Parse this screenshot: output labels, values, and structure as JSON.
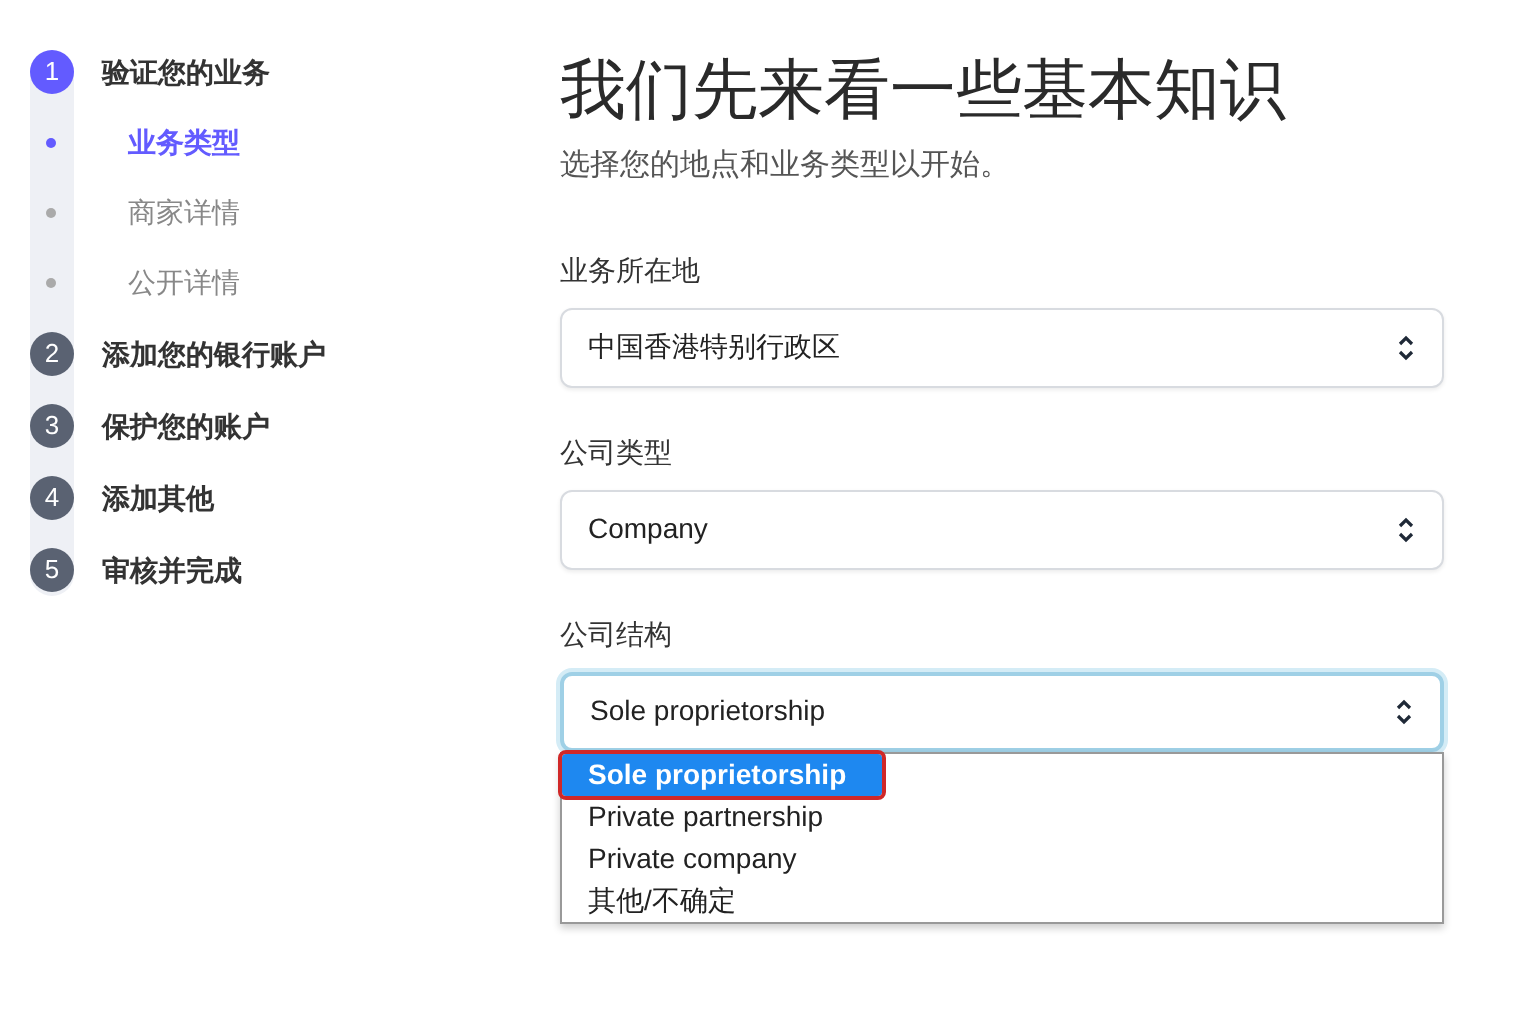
{
  "steps": [
    {
      "number": "1",
      "label": "验证您的业务",
      "current": true,
      "children": [
        {
          "label": "业务类型",
          "selected": true
        },
        {
          "label": "商家详情",
          "selected": false
        },
        {
          "label": "公开详情",
          "selected": false
        }
      ]
    },
    {
      "number": "2",
      "label": "添加您的银行账户",
      "current": false
    },
    {
      "number": "3",
      "label": "保护您的账户",
      "current": false
    },
    {
      "number": "4",
      "label": "添加其他",
      "current": false
    },
    {
      "number": "5",
      "label": "审核并完成",
      "current": false
    }
  ],
  "heading": "我们先来看一些基本知识",
  "subheading": "选择您的地点和业务类型以开始。",
  "fields": [
    {
      "label": "业务所在地",
      "value": "中国香港特别行政区",
      "focused": false
    },
    {
      "label": "公司类型",
      "value": "Company",
      "focused": false
    },
    {
      "label": "公司结构",
      "value": "Sole proprietorship",
      "focused": true,
      "options": [
        {
          "label": "Sole proprietorship",
          "selected": true,
          "annotated": true
        },
        {
          "label": "Private partnership",
          "selected": false,
          "annotated": false
        },
        {
          "label": "Private company",
          "selected": false,
          "annotated": false
        },
        {
          "label": "其他/不确定",
          "selected": false,
          "annotated": false
        }
      ]
    }
  ]
}
